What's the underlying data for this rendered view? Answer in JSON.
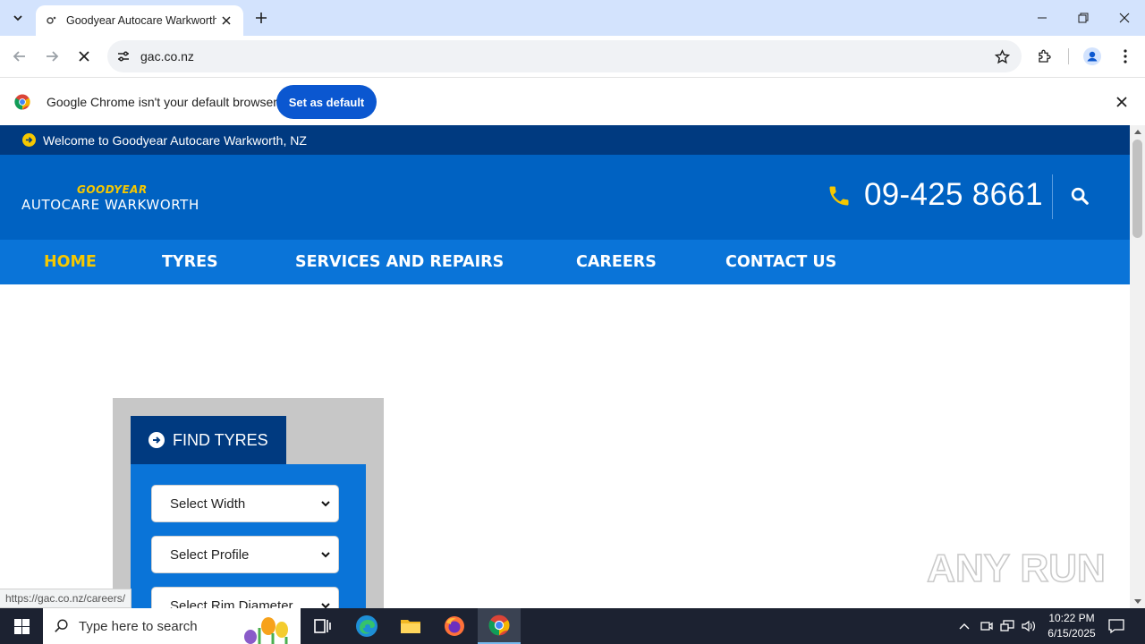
{
  "browser": {
    "tab_title": "Goodyear Autocare Warkworth, N",
    "url": "gac.co.nz",
    "infobar_text": "Google Chrome isn't your default browser",
    "set_default_label": "Set as default"
  },
  "page": {
    "welcome_text": "Welcome to Goodyear Autocare Warkworth, NZ",
    "logo_brand": "GOODYEAR",
    "logo_subtitle": "AUTOCARE WARKWORTH",
    "phone": "09-425 8661",
    "nav": [
      {
        "label": "HOME",
        "active": true
      },
      {
        "label": "TYRES",
        "active": false
      },
      {
        "label": "SERVICES AND REPAIRS",
        "active": false
      },
      {
        "label": "CAREERS",
        "active": false
      },
      {
        "label": "CONTACT US",
        "active": false
      }
    ],
    "finder": {
      "title": "FIND TYRES",
      "selects": [
        "Select Width",
        "Select Profile",
        "Select Rim Diameter"
      ]
    },
    "status_url": "https://gac.co.nz/careers/",
    "watermark": "ANY RUN"
  },
  "taskbar": {
    "search_placeholder": "Type here to search",
    "time": "10:22 PM",
    "date": "6/15/2025"
  },
  "colors": {
    "topbar": "#003a80",
    "header": "#0062c2",
    "nav": "#0a74d8",
    "accent_yellow": "#f6c800",
    "chrome_button": "#0b57d0"
  }
}
